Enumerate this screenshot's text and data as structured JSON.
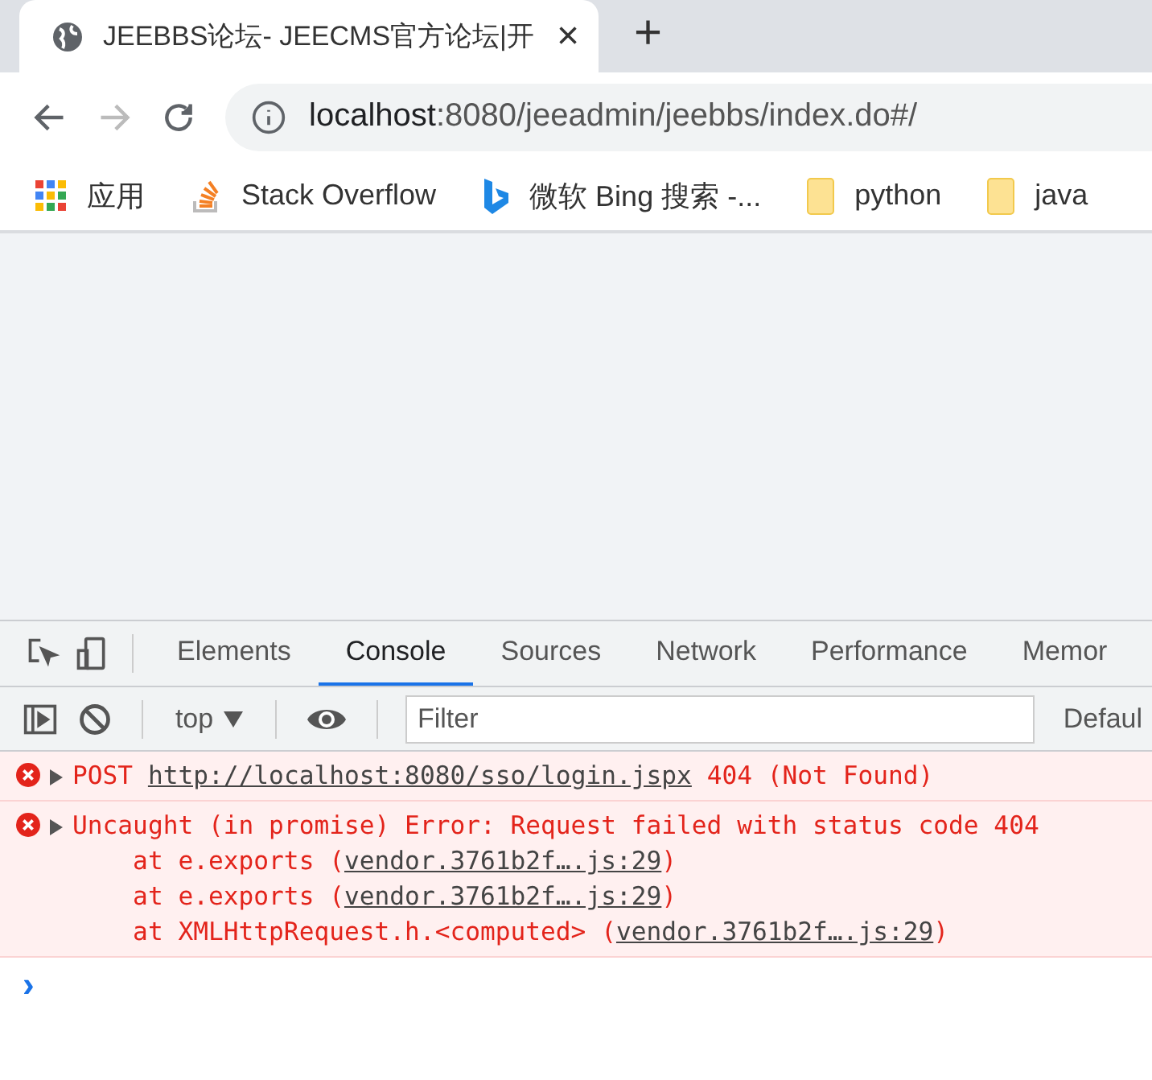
{
  "browser": {
    "tab": {
      "title": "JEEBBS论坛- JEECMS官方论坛|开",
      "close": "×"
    },
    "new_tab": "+",
    "address": {
      "host": "localhost",
      "path": ":8080/jeeadmin/jeebbs/index.do#/"
    },
    "bookmarks": [
      {
        "kind": "apps",
        "label": "应用"
      },
      {
        "kind": "stack",
        "label": "Stack Overflow"
      },
      {
        "kind": "bing",
        "label": "微软 Bing 搜索 -..."
      },
      {
        "kind": "folder",
        "label": "python"
      },
      {
        "kind": "folder",
        "label": "java"
      }
    ]
  },
  "devtools": {
    "tabs": [
      {
        "label": "Elements",
        "selected": false
      },
      {
        "label": "Console",
        "selected": true
      },
      {
        "label": "Sources",
        "selected": false
      },
      {
        "label": "Network",
        "selected": false
      },
      {
        "label": "Performance",
        "selected": false
      },
      {
        "label": "Memor",
        "selected": false
      }
    ],
    "context": "top",
    "filter": {
      "placeholder": "Filter"
    },
    "levels": "Defaul",
    "messages": [
      {
        "kind": "error",
        "lines": [
          {
            "before": "POST ",
            "link": "http://localhost:8080/sso/login.jspx",
            "after": " 404 (Not Found)"
          }
        ]
      },
      {
        "kind": "error",
        "lines": [
          {
            "before": "Uncaught (in promise) Error: Request failed with status code 404"
          },
          {
            "before": "    at e.exports (",
            "link": "vendor.3761b2f….js:29",
            "after": ")"
          },
          {
            "before": "    at e.exports (",
            "link": "vendor.3761b2f….js:29",
            "after": ")"
          },
          {
            "before": "    at XMLHttpRequest.h.<computed> (",
            "link": "vendor.3761b2f….js:29",
            "after": ")"
          }
        ]
      }
    ],
    "prompt": "›"
  }
}
